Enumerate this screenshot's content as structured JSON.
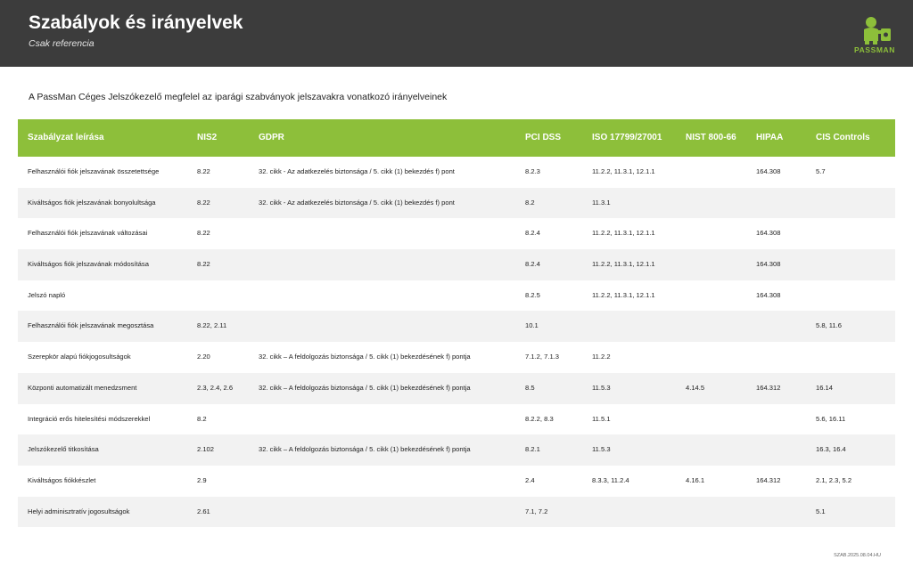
{
  "header": {
    "title": "Szabályok és irányelvek",
    "subtitle": "Csak referencia"
  },
  "logo": {
    "text": "PASSMAN",
    "color": "#8dbf3a"
  },
  "intro": "A PassMan Céges Jelszókezelő megfelel az iparági szabványok jelszavakra vonatkozó irányelveinek",
  "table": {
    "header_color": "#8dbf3a",
    "columns": [
      "Szabályzat leírása",
      "NIS2",
      "GDPR",
      "PCI DSS",
      "ISO 17799/27001",
      "NIST 800-66",
      "HIPAA",
      "CIS Controls"
    ],
    "rows": [
      [
        "Felhasználói fiók jelszavának összetettsége",
        "8.22",
        "32. cikk - Az adatkezelés biztonsága / 5. cikk (1) bekezdés f) pont",
        "8.2.3",
        "11.2.2, 11.3.1, 12.1.1",
        "",
        "164.308",
        "5.7"
      ],
      [
        "Kiváltságos fiók jelszavának bonyolultsága",
        "8.22",
        "32. cikk - Az adatkezelés biztonsága / 5. cikk (1) bekezdés f) pont",
        "8.2",
        "11.3.1",
        "",
        "",
        ""
      ],
      [
        "Felhasználói fiók jelszavának változásai",
        "8.22",
        "",
        "8.2.4",
        "11.2.2, 11.3.1, 12.1.1",
        "",
        "164.308",
        ""
      ],
      [
        "Kiváltságos fiók jelszavának módosítása",
        "8.22",
        "",
        "8.2.4",
        "11.2.2, 11.3.1, 12.1.1",
        "",
        "164.308",
        ""
      ],
      [
        "Jelszó napló",
        "",
        "",
        "8.2.5",
        "11.2.2, 11.3.1, 12.1.1",
        "",
        "164.308",
        ""
      ],
      [
        "Felhasználói fiók jelszavának megosztása",
        "8.22, 2.11",
        "",
        "10.1",
        "",
        "",
        "",
        "5.8, 11.6"
      ],
      [
        "Szerepkör alapú fiókjogosultságok",
        "2.20",
        "32. cikk – A feldolgozás biztonsága / 5. cikk (1) bekezdésének f) pontja",
        "7.1.2, 7.1.3",
        "11.2.2",
        "",
        "",
        ""
      ],
      [
        "Központi automatizált menedzsment",
        "2.3, 2.4, 2.6",
        "32. cikk – A feldolgozás biztonsága / 5. cikk (1) bekezdésének f) pontja",
        "8.5",
        "11.5.3",
        "4.14.5",
        "164.312",
        "16.14"
      ],
      [
        "Integráció erős hitelesítési módszerekkel",
        "8.2",
        "",
        "8.2.2, 8.3",
        "11.5.1",
        "",
        "",
        "5.6, 16.11"
      ],
      [
        "Jelszókezelő titkosítása",
        "2.102",
        "32. cikk – A feldolgozás biztonsága / 5. cikk (1) bekezdésének f) pontja",
        "8.2.1",
        "11.5.3",
        "",
        "",
        "16.3, 16.4"
      ],
      [
        "Kiváltságos fiókkészlet",
        "2.9",
        "",
        "2.4",
        "8.3.3, 11.2.4",
        "4.16.1",
        "164.312",
        "2.1, 2.3, 5.2"
      ],
      [
        "Helyi adminisztratív jogosultságok",
        "2.61",
        "",
        "7.1, 7.2",
        "",
        "",
        "",
        "5.1"
      ]
    ]
  },
  "footer": {
    "doc_code": "SZAB.2025.08.04.HU"
  }
}
